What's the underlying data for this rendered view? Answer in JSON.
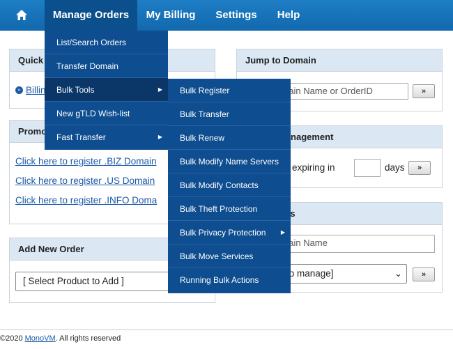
{
  "nav": {
    "items": [
      {
        "label": "Manage Orders"
      },
      {
        "label": "My Billing"
      },
      {
        "label": "Settings"
      },
      {
        "label": "Help"
      }
    ]
  },
  "quick": {
    "title_partial": "Quick",
    "link_partial": "Billin"
  },
  "promo": {
    "title_partial": "Promo",
    "links": [
      "Click here to register .BIZ Domain",
      "Click here to register .US Domain",
      "Click here to register .INFO Doma"
    ]
  },
  "add_order": {
    "title": "Add New Order",
    "select_value": "[ Select Product to Add ]"
  },
  "jump": {
    "title": "Jump to Domain",
    "placeholder": "nain Name or OrderID",
    "go": "»"
  },
  "renewal": {
    "title_partial": "enewal Management",
    "text_partial": "rs expiring in",
    "days": "days",
    "go": "»"
  },
  "free": {
    "title_partial": "ee Services",
    "placeholder": "nain Name",
    "select_partial": "to manage]",
    "go": "»"
  },
  "menu1": {
    "items": [
      {
        "label": "List/Search Orders"
      },
      {
        "label": "Transfer Domain"
      },
      {
        "label": "Bulk Tools"
      },
      {
        "label": "New gTLD Wish-list"
      },
      {
        "label": "Fast Transfer"
      }
    ]
  },
  "menu2": {
    "items": [
      {
        "label": "Bulk Register"
      },
      {
        "label": "Bulk Transfer"
      },
      {
        "label": "Bulk Renew"
      },
      {
        "label": "Bulk Modify Name Servers"
      },
      {
        "label": "Bulk Modify Contacts"
      },
      {
        "label": "Bulk Theft Protection"
      },
      {
        "label": "Bulk Privacy Protection"
      },
      {
        "label": "Bulk Move Services"
      },
      {
        "label": "Running Bulk Actions"
      }
    ]
  },
  "footer": {
    "prefix": "©2020 ",
    "brand": "MonoVM",
    "suffix": ". All rights reserved"
  },
  "colors": {
    "nav": "#1268ad",
    "menu": "#0e4d8f",
    "panel_head": "#dbe7f3",
    "link": "#1b5aa8"
  }
}
